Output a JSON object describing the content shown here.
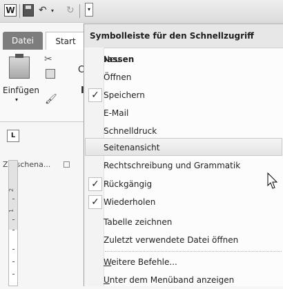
{
  "qat": {
    "app_icon_letter": "W",
    "undo_glyph": "↶",
    "undo_arrow": "▾",
    "redo_glyph": "↻",
    "customize_glyph": "▾"
  },
  "ribbon": {
    "tabs": [
      "Datei",
      "Start"
    ],
    "paste_label": "Einfügen",
    "paste_arrow": "▾",
    "group_label": "Zwischena...",
    "partial_font_letter": "C",
    "partial_bold_letter": "I"
  },
  "ruler": {
    "corner_glyph": "L",
    "numbers": [
      "2",
      "1"
    ]
  },
  "menu": {
    "header": "Symbolleiste für den Schnellzugriff anpassen",
    "items": [
      {
        "label": "Neu",
        "checked": false
      },
      {
        "label": "Öffnen",
        "checked": false
      },
      {
        "label": "Speichern",
        "checked": true
      },
      {
        "label": "E-Mail",
        "checked": false
      },
      {
        "label": "Schnelldruck",
        "checked": false
      },
      {
        "label": "Seitenansicht",
        "checked": false,
        "highlighted": true
      },
      {
        "label": "Rechtschreibung und Grammatik",
        "checked": false
      },
      {
        "label": "Rückgängig",
        "checked": true
      },
      {
        "label": "Wiederholen",
        "checked": true
      },
      {
        "label": "Tabelle zeichnen",
        "checked": false
      },
      {
        "label": "Zuletzt verwendete Datei öffnen",
        "checked": false
      }
    ],
    "more_commands": {
      "mnemonic": "W",
      "rest": "eitere Befehle..."
    },
    "show_below": {
      "mnemonic": "U",
      "rest": "nter dem Menüband anzeigen"
    },
    "check_glyph": "✓"
  }
}
